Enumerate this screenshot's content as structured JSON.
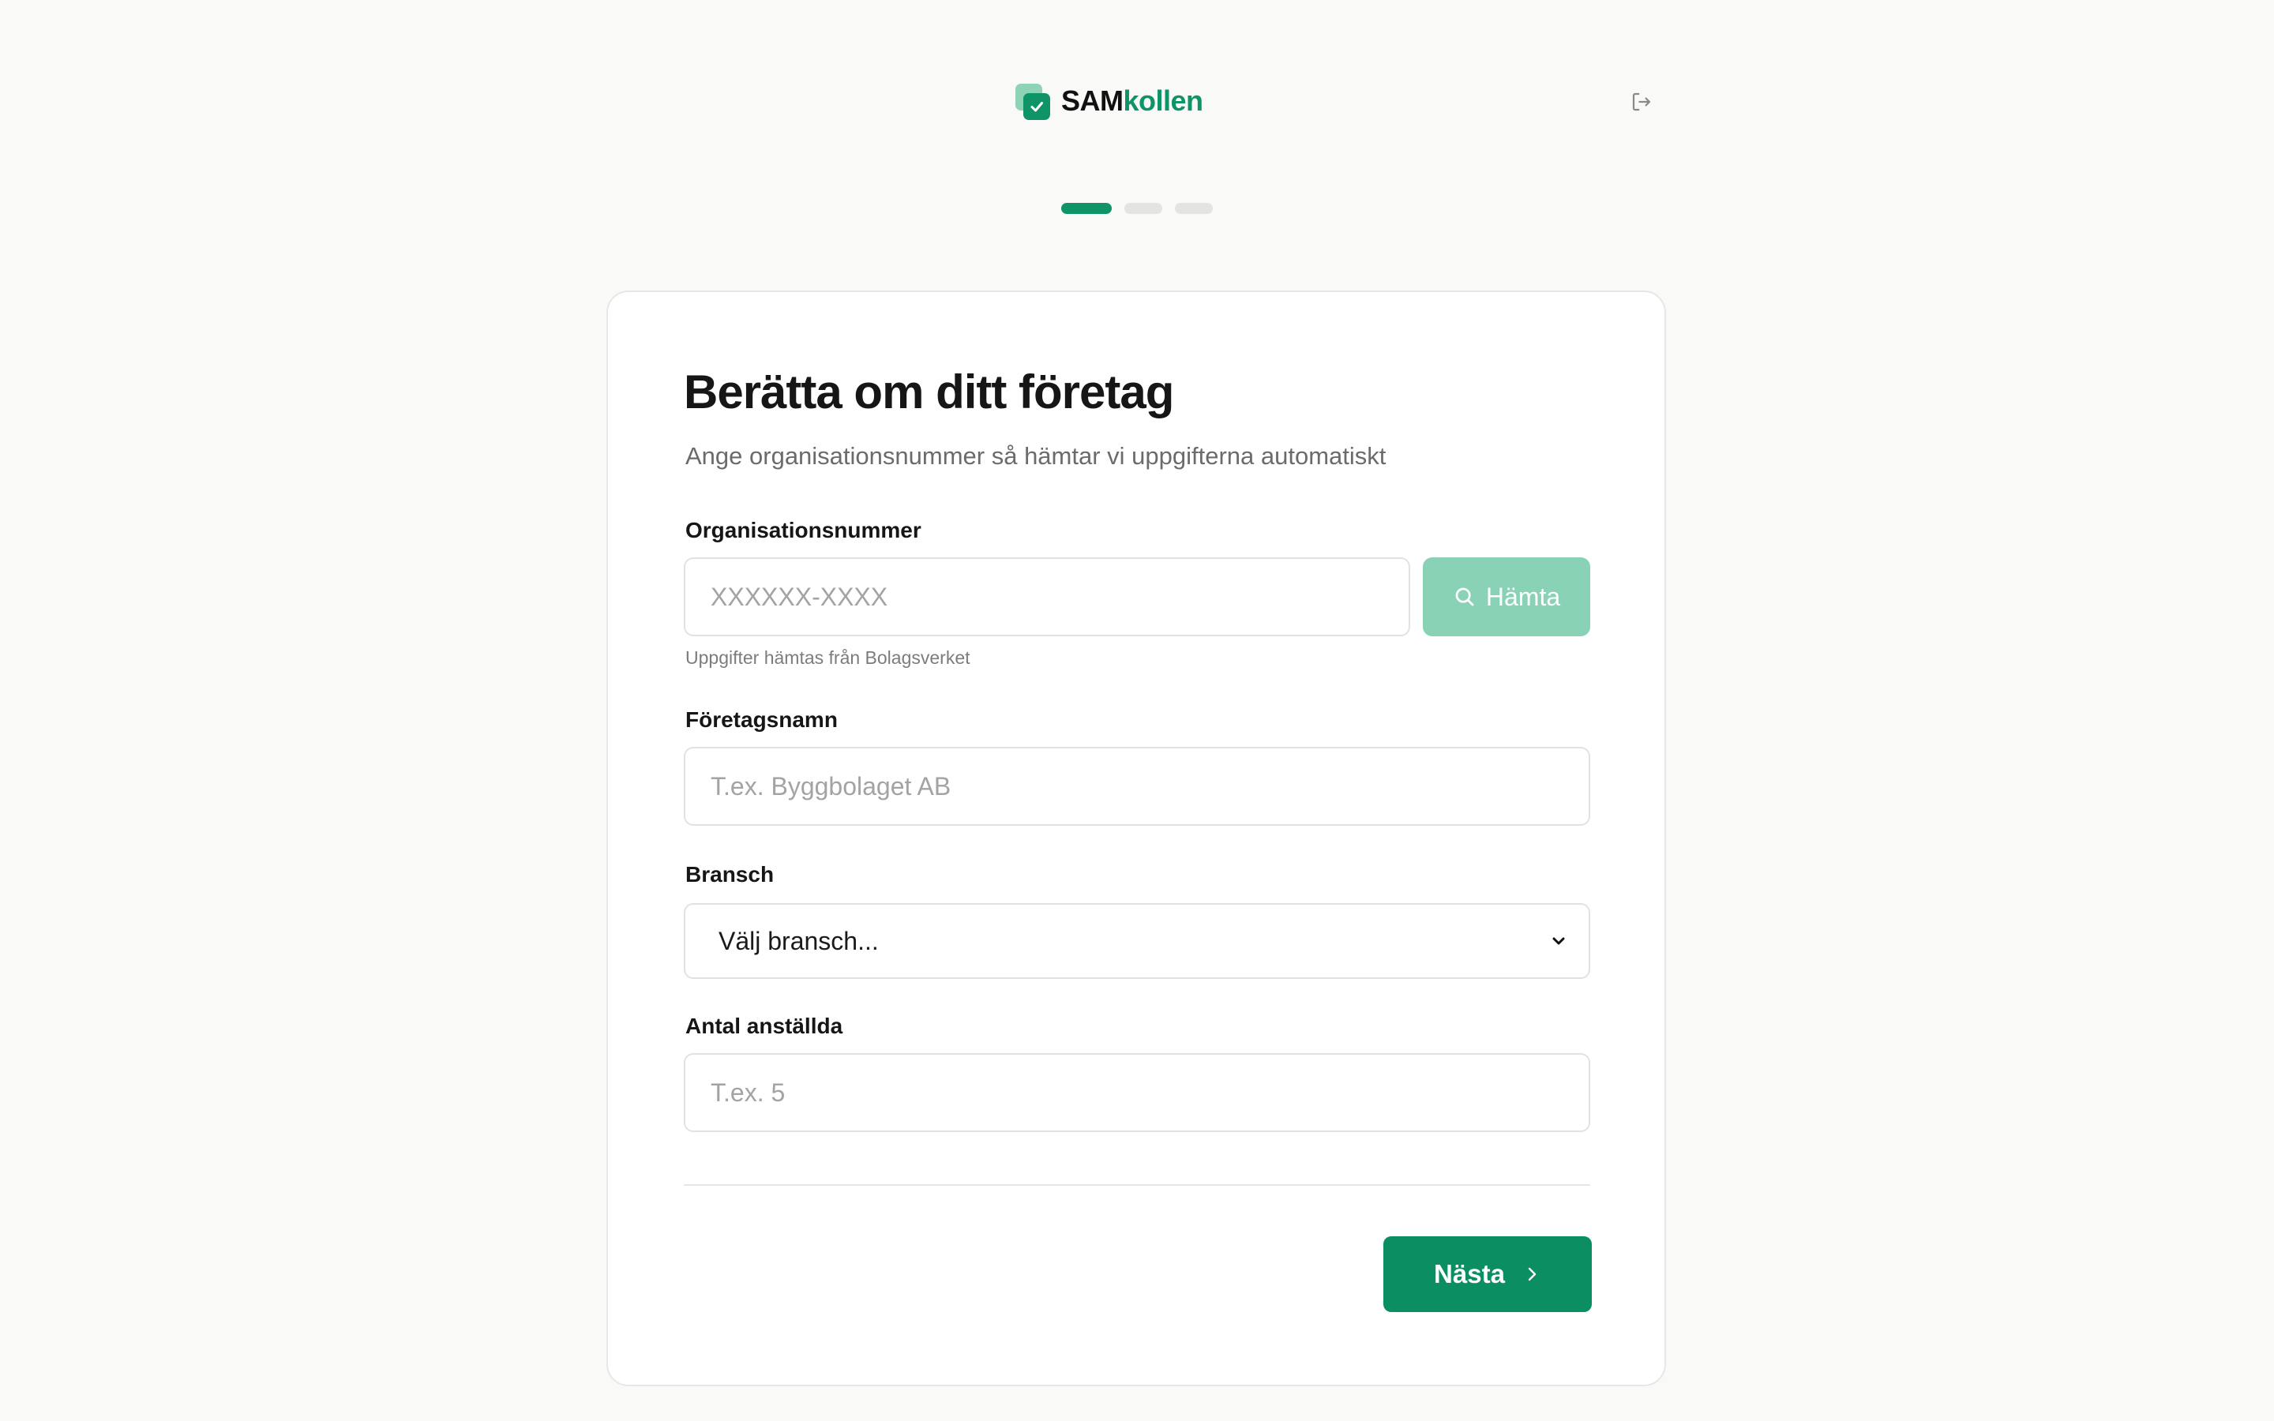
{
  "header": {
    "brand_part1": "SAM",
    "brand_part2": "kollen",
    "logo_icon": "checkbox-check-icon",
    "logout_icon": "logout-icon"
  },
  "stepper": {
    "total_steps": 3,
    "current_step": 1
  },
  "form": {
    "title": "Berätta om ditt företag",
    "subtitle": "Ange organisationsnummer så hämtar vi uppgifterna automatiskt",
    "org_number": {
      "label": "Organisationsnummer",
      "placeholder": "XXXXXX-XXXX",
      "value": "",
      "hint": "Uppgifter hämtas från Bolagsverket"
    },
    "fetch_button": {
      "label": "Hämta",
      "icon": "search-icon"
    },
    "company_name": {
      "label": "Företagsnamn",
      "placeholder": "T.ex. Byggbolaget AB",
      "value": ""
    },
    "industry": {
      "label": "Bransch",
      "selected": "Välj bransch...",
      "icon": "chevron-down-icon"
    },
    "employees": {
      "label": "Antal anställda",
      "placeholder": "T.ex. 5",
      "value": ""
    },
    "next_button": {
      "label": "Nästa",
      "icon": "chevron-right-icon"
    }
  },
  "colors": {
    "accent": "#0f9468",
    "accent_light": "#8ad2b6",
    "background": "#f9f9f8",
    "card": "#ffffff"
  }
}
